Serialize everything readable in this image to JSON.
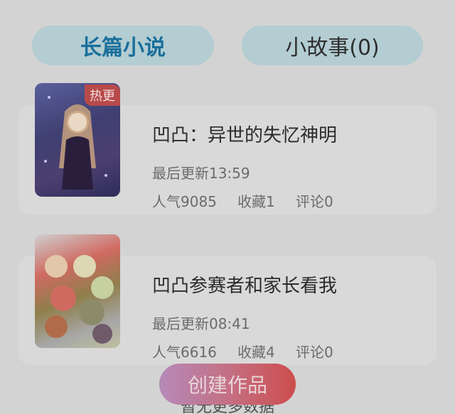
{
  "tabs": {
    "novel": "长篇小说",
    "short_story": "小故事(0)"
  },
  "works": [
    {
      "title": "凹凸：异世的失忆神明",
      "badge": "热更",
      "updated": "最后更新13:59",
      "popularity": "人气9085",
      "favorites": "收藏1",
      "comments": "评论0"
    },
    {
      "title": "凹凸参赛者和家长看我",
      "updated": "最后更新08:41",
      "popularity": "人气6616",
      "favorites": "收藏4",
      "comments": "评论0"
    }
  ],
  "create_button": "创建作品",
  "partial_hint": "暂无更多数据",
  "colors": {
    "tab_bg": "#b3cdd2",
    "tab_active_text": "#1a6f9b",
    "badge_bg": "#b84a4a",
    "create_gradient_start": "#b68ab9",
    "create_gradient_end": "#cd4d4d"
  }
}
